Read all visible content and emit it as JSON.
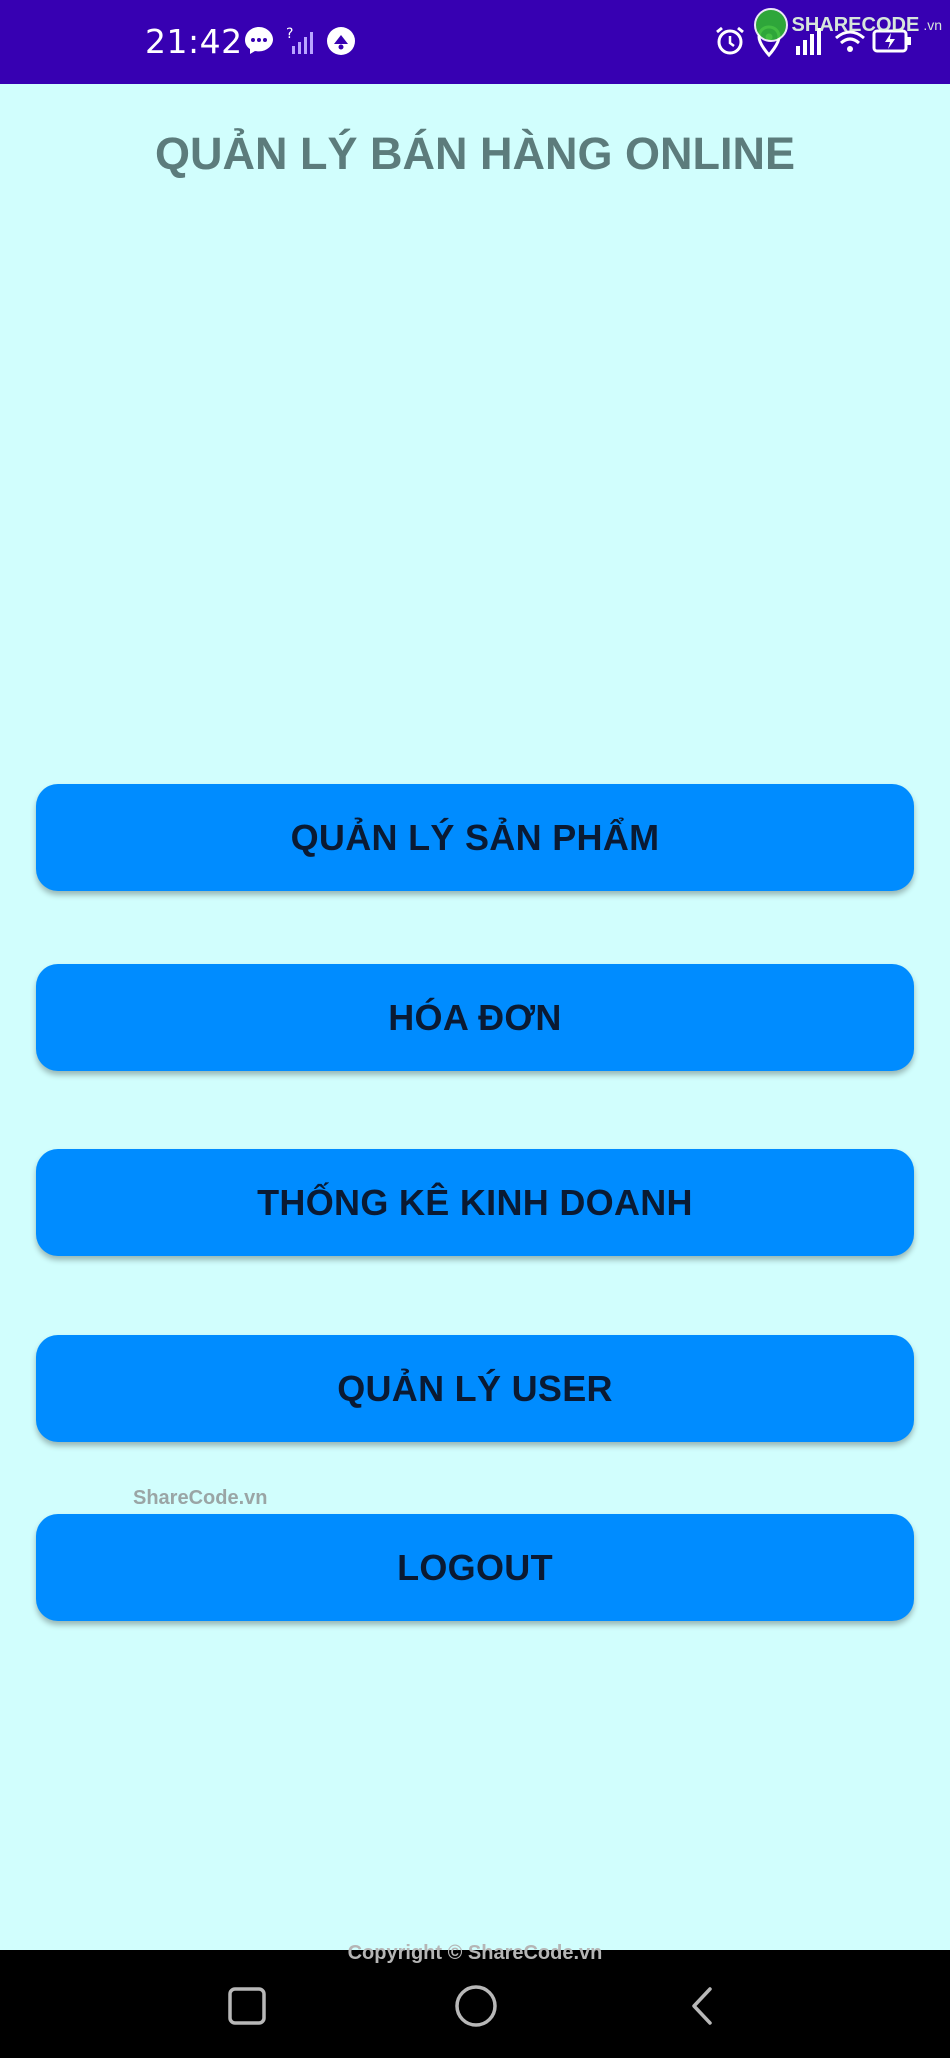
{
  "status_bar": {
    "time": "21:42",
    "watermark_brand": "SHARECODE",
    "watermark_suffix": ".vn",
    "icons": [
      "messenger-icon",
      "signal-unknown-icon",
      "app-notification-icon",
      "alarm-icon",
      "location-icon",
      "signal-icon",
      "wifi-icon",
      "battery-charging-icon"
    ]
  },
  "app": {
    "title": "QUẢN LÝ BÁN HÀNG ONLINE"
  },
  "menu": {
    "products": "QUẢN LÝ SẢN PHẨM",
    "invoices": "HÓA ĐƠN",
    "statistics": "THỐNG KÊ KINH DOANH",
    "users": "QUẢN LÝ USER",
    "logout": "LOGOUT"
  },
  "watermark": {
    "text": "ShareCode.vn",
    "copyright": "Copyright © ShareCode.vn"
  },
  "nav_bar": {
    "icons": [
      "recent-apps-icon",
      "home-icon",
      "back-icon"
    ]
  },
  "colors": {
    "status_bar": "#3700b2",
    "background": "#d1fefd",
    "button": "#008cff",
    "title": "#5c7c7c"
  }
}
